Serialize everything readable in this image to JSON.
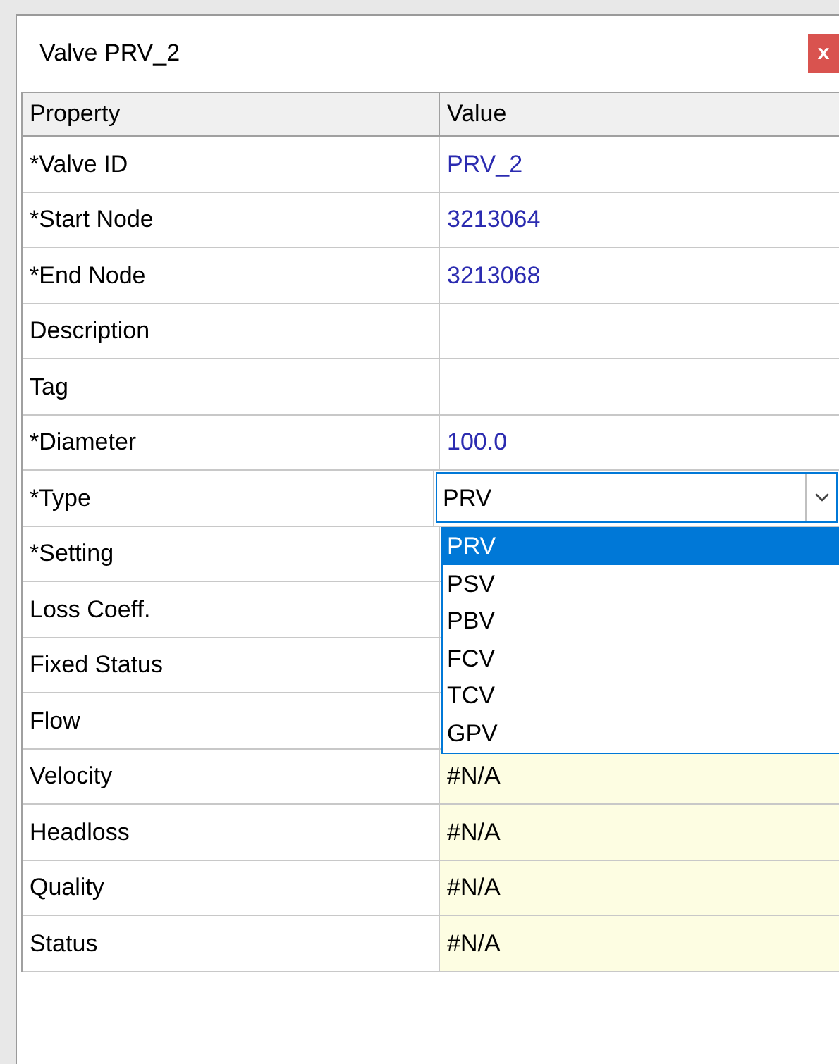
{
  "window": {
    "title": "Valve PRV_2",
    "close": "x"
  },
  "table": {
    "columns": [
      "Property",
      "Value"
    ],
    "rows": [
      {
        "property": "*Valve ID",
        "value": "PRV_2",
        "computed": false
      },
      {
        "property": "*Start Node",
        "value": "3213064",
        "computed": false
      },
      {
        "property": "*End Node",
        "value": "3213068",
        "computed": false
      },
      {
        "property": "Description",
        "computed": false
      },
      {
        "property": "Tag",
        "computed": false
      },
      {
        "property": "*Diameter",
        "value": "100.0",
        "computed": false
      },
      {
        "property": "*Type",
        "computed": false,
        "kind": "dropdown"
      },
      {
        "property": "*Setting",
        "computed": false
      },
      {
        "property": "Loss Coeff.",
        "computed": false
      },
      {
        "property": "Fixed Status",
        "computed": false
      },
      {
        "property": "Flow",
        "computed": false
      },
      {
        "property": "Velocity",
        "value": "#N/A",
        "computed": true
      },
      {
        "property": "Headloss",
        "value": "#N/A",
        "computed": true
      },
      {
        "property": "Quality",
        "value": "#N/A",
        "computed": true
      },
      {
        "property": "Status",
        "value": "#N/A",
        "computed": true
      }
    ]
  },
  "dropdown": {
    "value": "PRV",
    "options": [
      {
        "label": "PRV",
        "selected": true
      },
      {
        "label": "PSV",
        "selected": false
      },
      {
        "label": "PBV",
        "selected": false
      },
      {
        "label": "FCV",
        "selected": false
      },
      {
        "label": "TCV",
        "selected": false
      },
      {
        "label": "GPV",
        "selected": false
      }
    ]
  }
}
